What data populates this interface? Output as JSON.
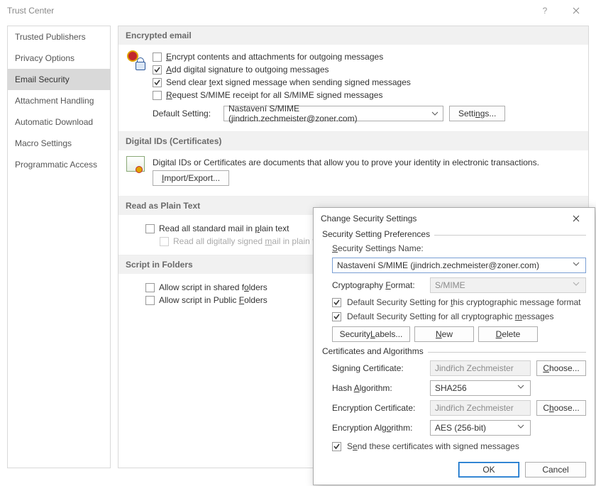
{
  "window": {
    "title": "Trust Center"
  },
  "sidebar": {
    "items": [
      {
        "label": "Trusted Publishers",
        "selected": false
      },
      {
        "label": "Privacy Options",
        "selected": false
      },
      {
        "label": "Email Security",
        "selected": true
      },
      {
        "label": "Attachment Handling",
        "selected": false
      },
      {
        "label": "Automatic Download",
        "selected": false
      },
      {
        "label": "Macro Settings",
        "selected": false
      },
      {
        "label": "Programmatic Access",
        "selected": false
      }
    ]
  },
  "sections": {
    "encrypted": {
      "title": "Encrypted email",
      "opt_encrypt": "Encrypt contents and attachments for outgoing messages",
      "opt_sign": "Add digital signature to outgoing messages",
      "opt_clear": "Send clear text signed message when sending signed messages",
      "opt_receipt": "Request S/MIME receipt for all S/MIME signed messages",
      "default_label": "Default Setting:",
      "default_value": "Nastavení S/MIME (jindrich.zechmeister@zoner.com)",
      "settings_btn": "Settings..."
    },
    "digital": {
      "title": "Digital IDs (Certificates)",
      "desc": "Digital IDs or Certificates are documents that allow you to prove your identity in electronic transactions.",
      "import_btn": "Import/Export..."
    },
    "plain": {
      "title": "Read as Plain Text",
      "opt_all": "Read all standard mail in plain text",
      "opt_signed": "Read all digitally signed mail in plain text"
    },
    "script": {
      "title": "Script in Folders",
      "opt_shared": "Allow script in shared folders",
      "opt_public": "Allow script in Public Folders"
    }
  },
  "modal": {
    "title": "Change Security Settings",
    "prefs_legend": "Security Setting Preferences",
    "name_label": "Security Settings Name:",
    "name_value": "Nastavení S/MIME (jindrich.zechmeister@zoner.com)",
    "crypto_label": "Cryptography Format:",
    "crypto_value": "S/MIME",
    "def_format": "Default Security Setting for this cryptographic message format",
    "def_all": "Default Security Setting for all cryptographic messages",
    "btn_labels": "Security Labels...",
    "btn_new": "New",
    "btn_delete": "Delete",
    "certs_legend": "Certificates and Algorithms",
    "sign_cert_label": "Signing Certificate:",
    "sign_cert_value": "Jindřich Zechmeister",
    "choose": "Choose...",
    "hash_label": "Hash Algorithm:",
    "hash_value": "SHA256",
    "enc_cert_label": "Encryption Certificate:",
    "enc_cert_value": "Jindřich Zechmeister",
    "enc_alg_label": "Encryption Algorithm:",
    "enc_alg_value": "AES (256-bit)",
    "send_certs": "Send these certificates with signed messages",
    "ok": "OK",
    "cancel": "Cancel"
  }
}
